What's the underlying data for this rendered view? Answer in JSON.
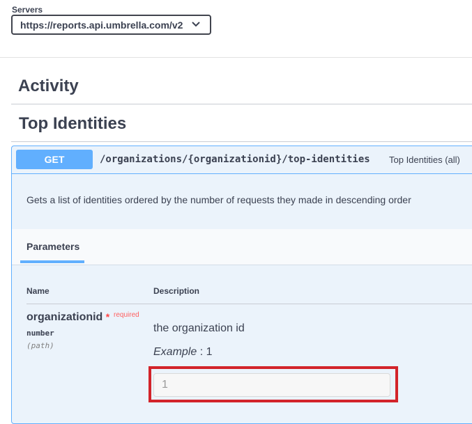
{
  "servers": {
    "label": "Servers",
    "selected": "https://reports.api.umbrella.com/v2"
  },
  "sections": {
    "activity": "Activity",
    "top_identities": "Top Identities"
  },
  "operation": {
    "method": "GET",
    "path": "/organizations/{organizationid}/top-identities",
    "summary": "Top Identities (all)",
    "description": "Gets a list of identities ordered by the number of requests they made in descending order",
    "method_color": "#61affe"
  },
  "parameters": {
    "tab_label": "Parameters",
    "col_name": "Name",
    "col_description": "Description",
    "items": [
      {
        "name": "organizationid",
        "required_mark": "*",
        "required_label": "required",
        "type": "number",
        "in": "(path)",
        "description": "the organization id",
        "example_label": "Example",
        "example_sep": " : ",
        "example_value": "1",
        "placeholder": "1"
      }
    ]
  },
  "highlight_color": "#d2232a"
}
